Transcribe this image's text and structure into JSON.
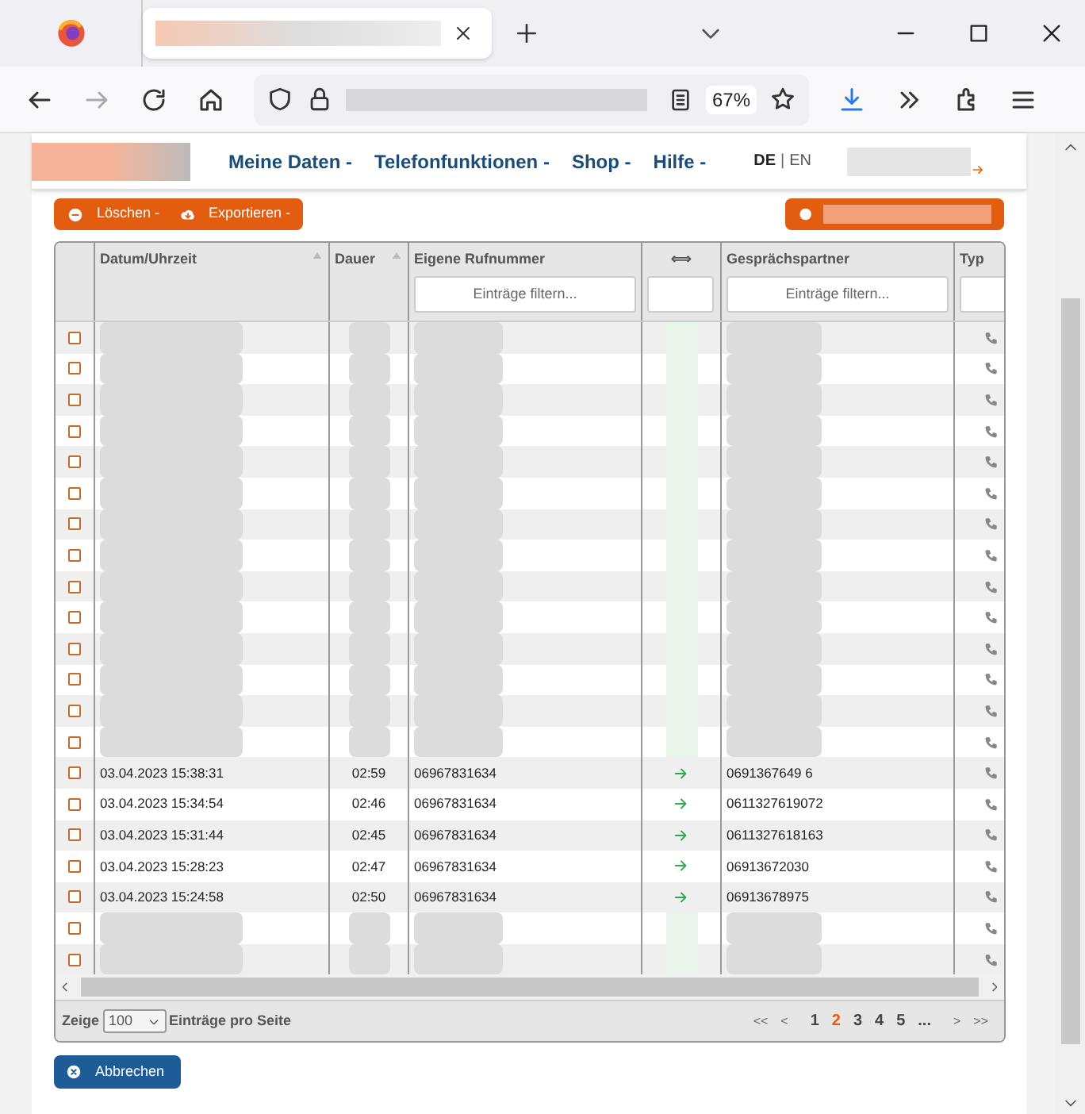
{
  "browser": {
    "zoom": "67%"
  },
  "nav": {
    "items": [
      {
        "label": "Meine Daten -"
      },
      {
        "label": "Telefonfunktionen -"
      },
      {
        "label": "Shop -"
      },
      {
        "label": "Hilfe -"
      }
    ],
    "language_separator": "|",
    "languages": [
      {
        "label": "DE",
        "selected": true
      },
      {
        "label": "EN",
        "selected": false
      }
    ]
  },
  "toolbar": {
    "buttons": [
      {
        "label": "Löschen -"
      },
      {
        "label": "Exportieren -"
      }
    ]
  },
  "table": {
    "columns": [
      {
        "label": "Datum/Uhrzeit",
        "sortable": true
      },
      {
        "label": "Dauer",
        "sortable": true
      },
      {
        "label": "Eigene Rufnummer",
        "filter_placeholder": "Einträge filtern..."
      },
      {
        "label": "⟺",
        "filter": true
      },
      {
        "label": "Gesprächspartner",
        "filter_placeholder": "Einträge filtern..."
      },
      {
        "label": "Typ",
        "filter": true
      }
    ],
    "rows": [
      {
        "kind": "redacted",
        "checked": false
      },
      {
        "kind": "redacted",
        "checked": false
      },
      {
        "kind": "redacted",
        "checked": false
      },
      {
        "kind": "redacted",
        "checked": false
      },
      {
        "kind": "redacted",
        "checked": false
      },
      {
        "kind": "redacted",
        "checked": false
      },
      {
        "kind": "redacted",
        "checked": false
      },
      {
        "kind": "redacted",
        "checked": false
      },
      {
        "kind": "redacted",
        "checked": false
      },
      {
        "kind": "redacted",
        "checked": false
      },
      {
        "kind": "redacted",
        "checked": false
      },
      {
        "kind": "redacted",
        "checked": false
      },
      {
        "kind": "redacted",
        "checked": false
      },
      {
        "kind": "redacted",
        "checked": false
      },
      {
        "kind": "call",
        "checked": false,
        "datetime": "03.04.2023 15:38:31",
        "duration": "02:59",
        "own_number": "06967831634",
        "partner": "0691367649 6"
      },
      {
        "kind": "call",
        "checked": false,
        "datetime": "03.04.2023 15:34:54",
        "duration": "02:46",
        "own_number": "06967831634",
        "partner": "0611327619072"
      },
      {
        "kind": "call",
        "checked": false,
        "datetime": "03.04.2023 15:31:44",
        "duration": "02:45",
        "own_number": "06967831634",
        "partner": "0611327618163"
      },
      {
        "kind": "call",
        "checked": false,
        "datetime": "03.04.2023 15:28:23",
        "duration": "02:47",
        "own_number": "06967831634",
        "partner": "06913672030"
      },
      {
        "kind": "call",
        "checked": false,
        "datetime": "03.04.2023 15:24:58",
        "duration": "02:50",
        "own_number": "06967831634",
        "partner": "06913678975"
      },
      {
        "kind": "redacted",
        "checked": false
      },
      {
        "kind": "redacted",
        "checked": false
      }
    ]
  },
  "footer": {
    "show_label": "Zeige",
    "per_page": "100",
    "per_page_label": "Einträge pro Seite",
    "pager": [
      {
        "label": "<<",
        "kind": "nav"
      },
      {
        "label": "<",
        "kind": "nav"
      },
      {
        "label": "1",
        "kind": "page",
        "selected": false
      },
      {
        "label": "2",
        "kind": "page",
        "selected": true
      },
      {
        "label": "3",
        "kind": "page",
        "selected": false
      },
      {
        "label": "4",
        "kind": "page",
        "selected": false
      },
      {
        "label": "5",
        "kind": "page",
        "selected": false
      },
      {
        "label": "...",
        "kind": "page",
        "selected": false
      },
      {
        "label": ">",
        "kind": "nav"
      },
      {
        "label": ">>",
        "kind": "nav"
      }
    ]
  },
  "cancel_button": {
    "label": "Abbrechen"
  }
}
